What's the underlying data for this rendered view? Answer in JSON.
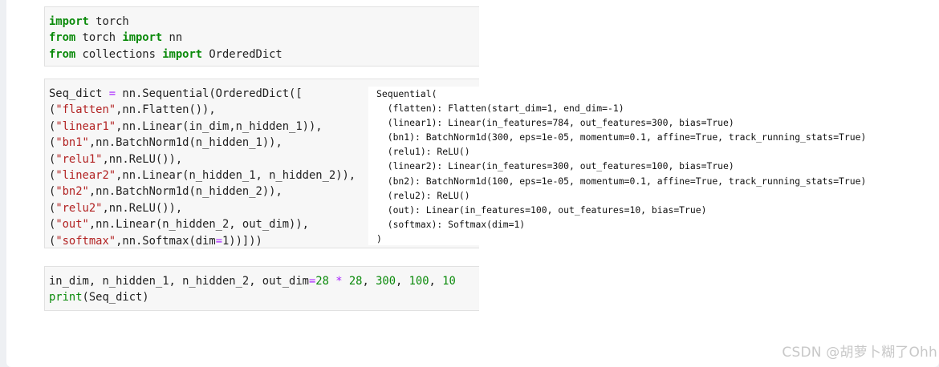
{
  "cells": [
    {
      "lines": [
        [
          {
            "t": "import",
            "c": "kw"
          },
          {
            "t": " torch"
          }
        ],
        [
          {
            "t": "from",
            "c": "kw"
          },
          {
            "t": " torch "
          },
          {
            "t": "import",
            "c": "kw"
          },
          {
            "t": " nn"
          }
        ],
        [
          {
            "t": "from",
            "c": "kw"
          },
          {
            "t": " collections "
          },
          {
            "t": "import",
            "c": "kw"
          },
          {
            "t": " OrderedDict"
          }
        ]
      ]
    },
    {
      "lines": [
        [
          {
            "t": "Seq_dict "
          },
          {
            "t": "=",
            "c": "op"
          },
          {
            "t": " nn.Sequential(OrderedDict(["
          }
        ],
        [
          {
            "t": "("
          },
          {
            "t": "\"flatten\"",
            "c": "str"
          },
          {
            "t": ",nn.Flatten()),"
          }
        ],
        [
          {
            "t": "("
          },
          {
            "t": "\"linear1\"",
            "c": "str"
          },
          {
            "t": ",nn.Linear(in_dim,n_hidden_1)),"
          }
        ],
        [
          {
            "t": "("
          },
          {
            "t": "\"bn1\"",
            "c": "str"
          },
          {
            "t": ",nn.BatchNorm1d(n_hidden_1)),"
          }
        ],
        [
          {
            "t": "("
          },
          {
            "t": "\"relu1\"",
            "c": "str"
          },
          {
            "t": ",nn.ReLU()),"
          }
        ],
        [
          {
            "t": "("
          },
          {
            "t": "\"linear2\"",
            "c": "str"
          },
          {
            "t": ",nn.Linear(n_hidden_1, n_hidden_2)),"
          }
        ],
        [
          {
            "t": "("
          },
          {
            "t": "\"bn2\"",
            "c": "str"
          },
          {
            "t": ",nn.BatchNorm1d(n_hidden_2)),"
          }
        ],
        [
          {
            "t": "("
          },
          {
            "t": "\"relu2\"",
            "c": "str"
          },
          {
            "t": ",nn.ReLU()),"
          }
        ],
        [
          {
            "t": "("
          },
          {
            "t": "\"out\"",
            "c": "str"
          },
          {
            "t": ",nn.Linear(n_hidden_2, out_dim)),"
          }
        ],
        [
          {
            "t": "("
          },
          {
            "t": "\"softmax\"",
            "c": "str"
          },
          {
            "t": ",nn.Softmax(dim"
          },
          {
            "t": "=",
            "c": "op"
          },
          {
            "t": "1))]))"
          }
        ]
      ]
    },
    {
      "lines": [
        [
          {
            "t": "in_dim, n_hidden_1, n_hidden_2, out_dim"
          },
          {
            "t": "=",
            "c": "op"
          },
          {
            "t": "28",
            "c": "num"
          },
          {
            "t": " "
          },
          {
            "t": "*",
            "c": "op"
          },
          {
            "t": " "
          },
          {
            "t": "28",
            "c": "num"
          },
          {
            "t": ", "
          },
          {
            "t": "300",
            "c": "num"
          },
          {
            "t": ", "
          },
          {
            "t": "100",
            "c": "num"
          },
          {
            "t": ", "
          },
          {
            "t": "10",
            "c": "num"
          }
        ],
        [
          {
            "t": "print",
            "c": "kw2"
          },
          {
            "t": "(Seq_dict)"
          }
        ]
      ]
    }
  ],
  "output": "Sequential(\n  (flatten): Flatten(start_dim=1, end_dim=-1)\n  (linear1): Linear(in_features=784, out_features=300, bias=True)\n  (bn1): BatchNorm1d(300, eps=1e-05, momentum=0.1, affine=True, track_running_stats=True)\n  (relu1): ReLU()\n  (linear2): Linear(in_features=300, out_features=100, bias=True)\n  (bn2): BatchNorm1d(100, eps=1e-05, momentum=0.1, affine=True, track_running_stats=True)\n  (relu2): ReLU()\n  (out): Linear(in_features=100, out_features=10, bias=True)\n  (softmax): Softmax(dim=1)\n)",
  "watermark": "CSDN @胡萝卜糊了Ohh"
}
